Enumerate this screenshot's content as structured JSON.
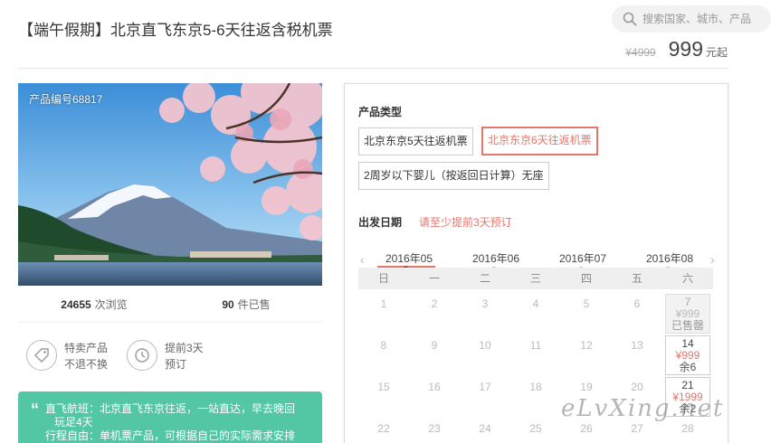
{
  "title": "【端午假期】北京直飞东京5-6天往返含税机票",
  "search": {
    "placeholder": "搜索国家、城市、产品"
  },
  "price": {
    "original": "¥4999",
    "current": "999",
    "unit": "元起"
  },
  "product_code": "产品编号68817",
  "stats": {
    "views_count": "24655",
    "views_label": "次浏览",
    "sold_count": "90",
    "sold_label": "件已售"
  },
  "features": [
    {
      "icon": "tag-icon",
      "line1": "特卖产品",
      "line2": "不退不换"
    },
    {
      "icon": "clock-icon",
      "line1": "提前3天",
      "line2": "预订"
    }
  ],
  "highlights": [
    "直飞航班：北京直飞东京往返，一站直达，早去晚回",
    "玩足4天",
    "行程自由：单机票产品，可根据自己的实际需求安排"
  ],
  "product_type": {
    "label": "产品类型",
    "options": [
      "北京东京5天往返机票",
      "北京东京6天往返机票",
      "2周岁以下婴儿（按返回日计算）无座"
    ],
    "selected_index": 1
  },
  "departure": {
    "label": "出发日期",
    "note": "请至少提前3天预订"
  },
  "calendar": {
    "months": [
      "2016年05",
      "2016年06",
      "2016年07",
      "2016年08"
    ],
    "active_month": 0,
    "weekdays": [
      "日",
      "一",
      "二",
      "三",
      "四",
      "五",
      "六"
    ],
    "rows": [
      [
        {
          "d": "1"
        },
        {
          "d": "2"
        },
        {
          "d": "3"
        },
        {
          "d": "4"
        },
        {
          "d": "5"
        },
        {
          "d": "6"
        },
        {
          "d": "7",
          "price": "¥999",
          "status": "已售罄",
          "soldout": true
        }
      ],
      [
        {
          "d": "8"
        },
        {
          "d": "9"
        },
        {
          "d": "10"
        },
        {
          "d": "11"
        },
        {
          "d": "12"
        },
        {
          "d": "13"
        },
        {
          "d": "14",
          "price": "¥999",
          "status": "余6"
        }
      ],
      [
        {
          "d": "15"
        },
        {
          "d": "16"
        },
        {
          "d": "17"
        },
        {
          "d": "18"
        },
        {
          "d": "19"
        },
        {
          "d": "20"
        },
        {
          "d": "21",
          "price": "¥1999",
          "status": "余2"
        }
      ],
      [
        {
          "d": "22"
        },
        {
          "d": "23"
        },
        {
          "d": "24"
        },
        {
          "d": "25"
        },
        {
          "d": "26"
        },
        {
          "d": "27"
        },
        {
          "d": "28"
        }
      ]
    ]
  },
  "watermark": "eLvXing.net",
  "colors": {
    "accent": "#e0786d",
    "highlight_bg": "#53c6a4"
  }
}
